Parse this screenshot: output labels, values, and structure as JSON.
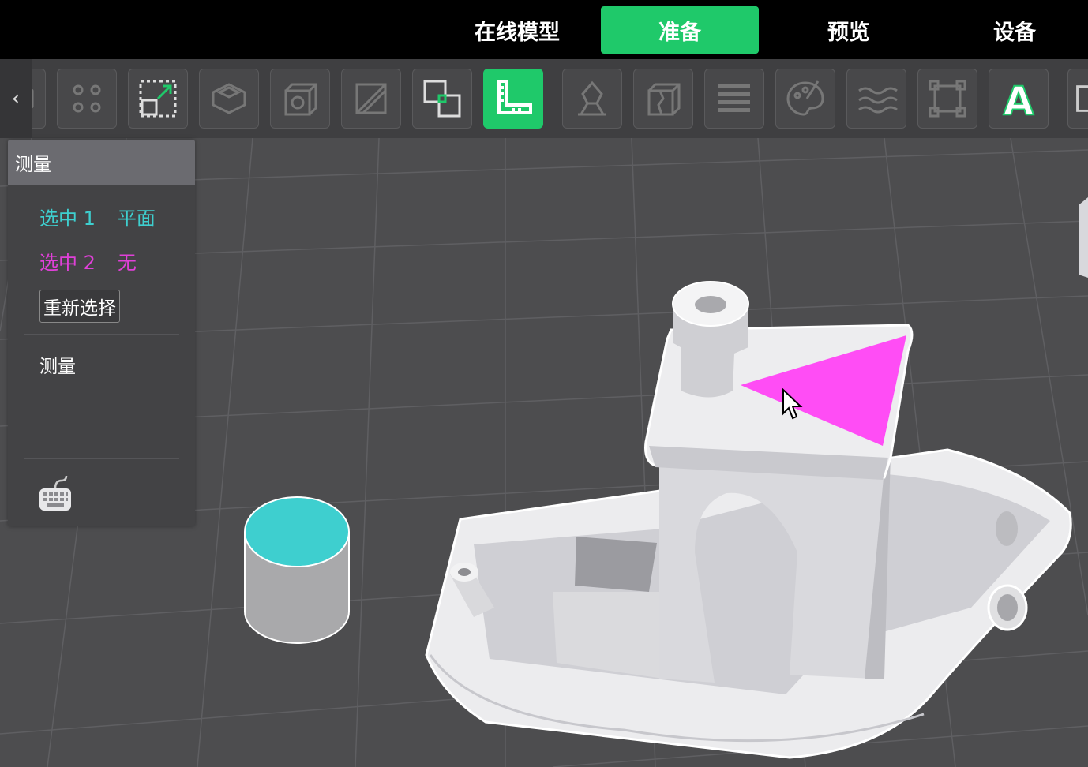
{
  "nav": {
    "tabs": [
      {
        "label": "在线模型",
        "active": false
      },
      {
        "label": "准备",
        "active": true
      },
      {
        "label": "预览",
        "active": false
      },
      {
        "label": "设备",
        "active": false
      }
    ]
  },
  "toolbar": {
    "collapse_glyph": "‹",
    "tools": [
      {
        "icon": "partial-tool-icon",
        "active": false
      },
      {
        "icon": "arrange-icon",
        "active": false
      },
      {
        "icon": "scale-icon",
        "active": false
      },
      {
        "icon": "hollow-icon",
        "active": false
      },
      {
        "icon": "cube-hole-icon",
        "active": false
      },
      {
        "icon": "cut-icon",
        "active": false
      },
      {
        "icon": "boolean-icon",
        "active": false
      },
      {
        "icon": "measure-ruler-icon",
        "active": true
      },
      {
        "icon": "support-icon",
        "active": false
      },
      {
        "icon": "split-cube-icon",
        "active": false
      },
      {
        "icon": "layers-icon",
        "active": false
      },
      {
        "icon": "paint-palette-icon",
        "active": false
      },
      {
        "icon": "wave-texture-icon",
        "active": false
      },
      {
        "icon": "bounding-frame-icon",
        "active": false
      },
      {
        "icon": "text-a-icon",
        "active": false,
        "text": "A"
      },
      {
        "icon": "partial-tool-icon",
        "active": false
      }
    ]
  },
  "panel": {
    "title": "测量",
    "selection1": {
      "label": "选中 1",
      "value": "平面",
      "color": "#3ecfcf"
    },
    "selection2": {
      "label": "选中 2",
      "value": "无",
      "color": "#e040d8"
    },
    "reselect_button": "重新选择",
    "measure_label": "测量",
    "keyboard_icon": "keyboard-icon"
  },
  "colors": {
    "accent": "#1fc96a",
    "selection1": "#3ecfcf",
    "selection2": "#ff4df5",
    "viewport_bg": "#4d4d4f"
  }
}
